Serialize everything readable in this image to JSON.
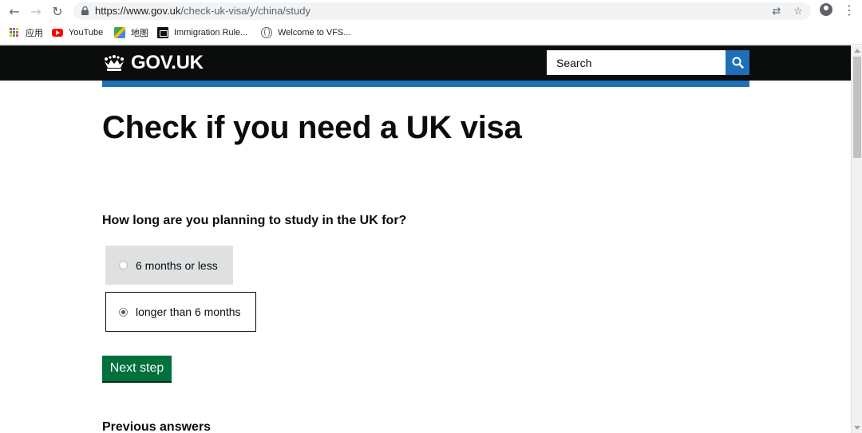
{
  "browser": {
    "url_host": "https://www.gov.uk",
    "url_path": "/check-uk-visa/y/china/study",
    "bookmarks": [
      "应用",
      "YouTube",
      "地图",
      "Immigration Rule...",
      "Welcome to VFS..."
    ]
  },
  "header": {
    "logo_text": "GOV.UK",
    "search_placeholder": "Search"
  },
  "main": {
    "title": "Check if you need a UK visa",
    "question": "How long are you planning to study in the UK for?",
    "options": [
      {
        "label": "6 months or less",
        "selected": false
      },
      {
        "label": "longer than 6 months",
        "selected": true
      }
    ],
    "next_button": "Next step",
    "previous_answers_heading": "Previous answers"
  },
  "colors": {
    "header_bg": "#0b0c0c",
    "brand_blue": "#1d70b8",
    "button_green": "#00703c"
  }
}
